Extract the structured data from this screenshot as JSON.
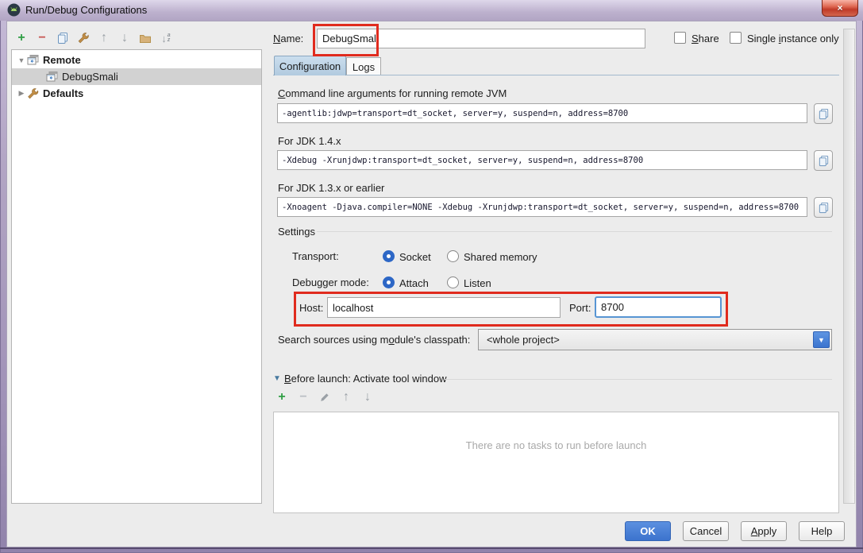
{
  "window": {
    "title": "Run/Debug Configurations",
    "close_glyph": "×"
  },
  "colors": {
    "accent_blue": "#3c73cd",
    "annotation_red": "#e02b1e",
    "tab_active_blue": "#b9cfe3",
    "tree_selection_gray": "#d2d2d2"
  },
  "left_toolbar": {
    "add_glyph": "+",
    "remove_glyph": "−",
    "up_glyph": "↑",
    "down_glyph": "↓",
    "sort_letters_top": "a",
    "sort_letters_bottom": "z"
  },
  "tree": {
    "items": [
      {
        "label": "Remote",
        "type": "group",
        "expanded": true
      },
      {
        "label": "DebugSmali",
        "selected": true
      },
      {
        "label": "Defaults",
        "type": "group",
        "expanded": false
      }
    ],
    "expanded_glyph": "▼",
    "collapsed_glyph": "▶"
  },
  "header": {
    "name_label": {
      "mn": "N",
      "post": "ame:"
    },
    "name_value": "DebugSmali",
    "share_label": {
      "mn": "S",
      "post": "hare"
    },
    "single_instance_label": {
      "pre": "Single ",
      "mn": "i",
      "post": "nstance only"
    }
  },
  "tabs": {
    "configuration": "Configuration",
    "logs": "Logs"
  },
  "config": {
    "cmdline_label": {
      "mn": "C",
      "post": "ommand line arguments for running remote JVM"
    },
    "cmdline_value": "-agentlib:jdwp=transport=dt_socket, server=y, suspend=n, address=8700",
    "jdk14_label": "For JDK 1.4.x",
    "jdk14_value": "-Xdebug -Xrunjdwp:transport=dt_socket, server=y, suspend=n, address=8700",
    "jdk13_label": "For JDK 1.3.x or earlier",
    "jdk13_value": "-Xnoagent -Djava.compiler=NONE -Xdebug -Xrunjdwp:transport=dt_socket, server=y, suspend=n, address=8700",
    "settings_label": "Settings",
    "transport_label": "Transport:",
    "transport_socket": "Socket",
    "transport_shared": "Shared memory",
    "transport_selected": "Socket",
    "debugger_label": "Debugger mode:",
    "debugger_attach": "Attach",
    "debugger_listen": "Listen",
    "debugger_selected": "Attach",
    "host_label": "Host:",
    "host_value": "localhost",
    "port_label": "Port:",
    "port_value": "8700",
    "search_label": {
      "pre": "Search sources using m",
      "mn": "o",
      "post": "dule's classpath:"
    },
    "search_value": "<whole project>",
    "dropdown_arrow_glyph": "▼"
  },
  "before_launch": {
    "expander_glyph": "▼",
    "title": {
      "mn": "B",
      "post": "efore launch: Activate tool window"
    },
    "toolbar": {
      "add_glyph": "+",
      "remove_glyph": "−",
      "up_glyph": "↑",
      "down_glyph": "↓"
    },
    "empty_text": "There are no tasks to run before launch"
  },
  "footer": {
    "ok": "OK",
    "cancel": "Cancel",
    "apply": {
      "mn": "A",
      "post": "pply"
    },
    "help": "Help"
  }
}
